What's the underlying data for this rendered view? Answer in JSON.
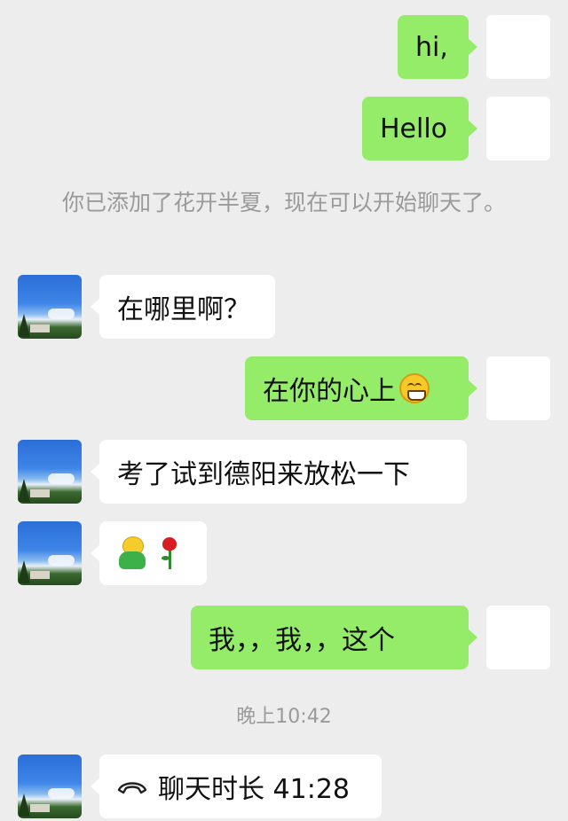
{
  "messages": [
    {
      "side": "self",
      "text": "hi,"
    },
    {
      "side": "self",
      "text": "Hello"
    },
    {
      "type": "system",
      "text": "你已添加了花开半夏，现在可以开始聊天了。"
    },
    {
      "side": "peer",
      "text": "在哪里啊？"
    },
    {
      "side": "self",
      "text": "在你的心上"
    },
    {
      "side": "peer",
      "text": "考了试到德阳来放松一下"
    },
    {
      "side": "peer",
      "emoji": [
        "smiling-bear-emoji",
        "rose-emoji"
      ]
    },
    {
      "side": "self",
      "text": "我，，我，，这个"
    },
    {
      "type": "time",
      "text": "晚上10:42"
    },
    {
      "side": "peer",
      "call": true,
      "text": "聊天时长 41:28"
    }
  ],
  "colors": {
    "background": "#ededed",
    "self_bubble": "#95ec69",
    "peer_bubble": "#ffffff",
    "system_text": "#9a9a9a"
  }
}
